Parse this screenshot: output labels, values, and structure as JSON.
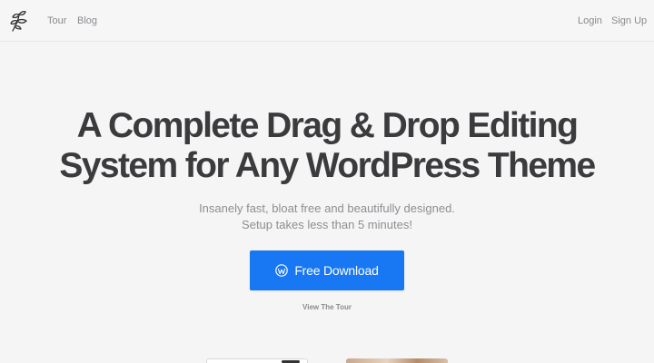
{
  "header": {
    "logo_icon": "leaf-branch-icon",
    "nav_left": [
      {
        "label": "Tour"
      },
      {
        "label": "Blog"
      }
    ],
    "nav_right": [
      {
        "label": "Login"
      },
      {
        "label": "Sign Up"
      }
    ]
  },
  "hero": {
    "title_line1": "A Complete Drag & Drop Editing",
    "title_line2": "System for Any WordPress Theme",
    "subtitle_line1": "Insanely fast, bloat free and beautifully designed.",
    "subtitle_line2": "Setup takes less than 5 minutes!",
    "cta_label": "Free Download",
    "cta_icon": "wordpress-icon",
    "secondary_link": "View The Tour"
  },
  "colors": {
    "accent": "#1877f2",
    "background": "#f5f5f6",
    "heading": "#3b3b3d",
    "muted": "#8e8e92"
  }
}
